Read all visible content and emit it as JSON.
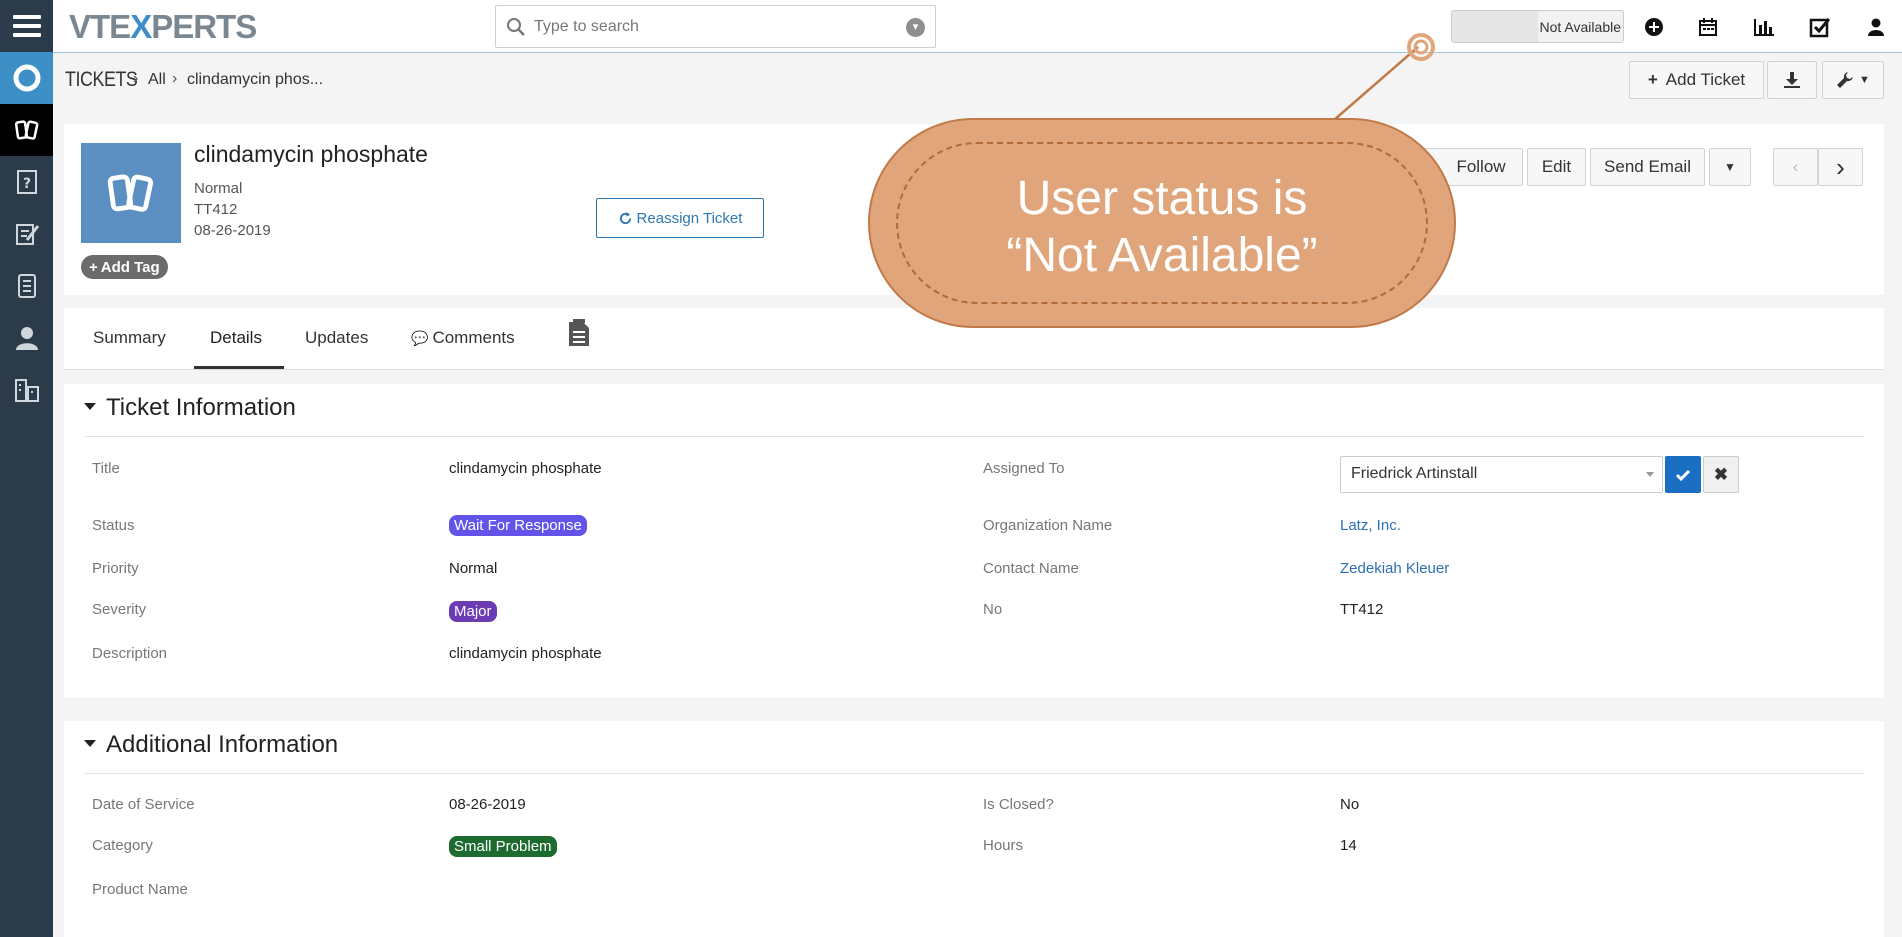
{
  "app": {
    "logo_left": "VTE",
    "logo_x": "X",
    "logo_right": "PERTS"
  },
  "search": {
    "placeholder": "Type to search"
  },
  "user_status": {
    "label": "Not Available"
  },
  "breadcrumb": {
    "module": "TICKETS",
    "filter": "All",
    "record": "clindamycin phos..."
  },
  "toolbar": {
    "add_ticket": "Add Ticket"
  },
  "record": {
    "title": "clindamycin phosphate",
    "priority": "Normal",
    "number": "TT412",
    "date": "08-26-2019",
    "add_tag": "Add Tag",
    "reassign": "Reassign Ticket"
  },
  "actions": {
    "follow": "Follow",
    "edit": "Edit",
    "send_email": "Send Email"
  },
  "tabs": {
    "summary": "Summary",
    "details": "Details",
    "updates": "Updates",
    "comments": "Comments"
  },
  "ticket_info": {
    "heading": "Ticket Information",
    "title_label": "Title",
    "title_value": "clindamycin phosphate",
    "status_label": "Status",
    "status_value": "Wait For Response",
    "priority_label": "Priority",
    "priority_value": "Normal",
    "severity_label": "Severity",
    "severity_value": "Major",
    "description_label": "Description",
    "description_value": "clindamycin phosphate",
    "assigned_label": "Assigned To",
    "assigned_value": "Friedrick Artinstall",
    "org_label": "Organization Name",
    "org_value": "Latz, Inc.",
    "contact_label": "Contact Name",
    "contact_value": "Zedekiah Kleuer",
    "no_label": "No",
    "no_value": "TT412"
  },
  "additional_info": {
    "heading": "Additional Information",
    "dos_label": "Date of Service",
    "dos_value": "08-26-2019",
    "category_label": "Category",
    "category_value": "Small Problem",
    "product_label": "Product Name",
    "product_value": "",
    "closed_label": "Is Closed?",
    "closed_value": "No",
    "hours_label": "Hours",
    "hours_value": "14"
  },
  "callout": {
    "line1": "User status is",
    "line2": "“Not Available”"
  },
  "colors": {
    "sidebar": "#2c3b49",
    "status_badge": "#6254e8",
    "severity_badge": "#6a3bb3",
    "category_badge": "#1e6b2f",
    "link": "#2f6fb5",
    "callout": "#e1a57b"
  }
}
